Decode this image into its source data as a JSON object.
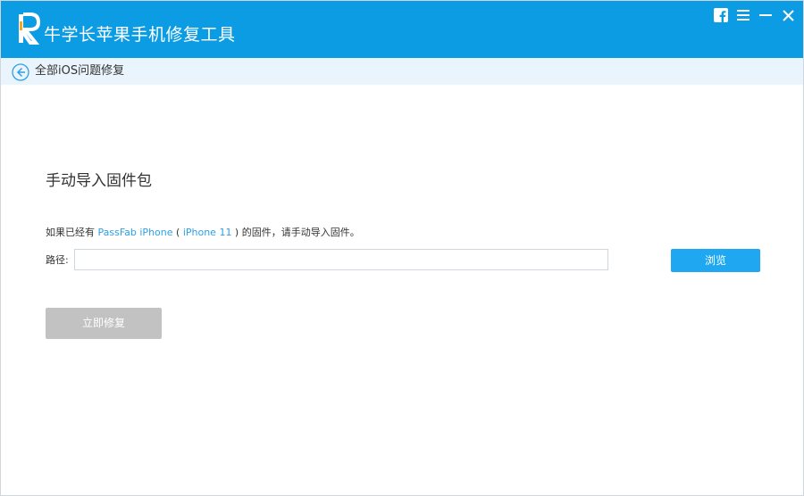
{
  "app": {
    "title": "牛学长苹果手机修复工具",
    "colors": {
      "titlebar": "#0c9ce4",
      "navbar": "#e9f4fc",
      "accent": "#1fa8f1",
      "link": "#2f9fe6",
      "disabled": "#c2c2c2"
    },
    "window_controls": [
      "facebook-icon",
      "menu-icon",
      "minimize-icon",
      "close-icon"
    ]
  },
  "nav": {
    "back_icon": "back-arrow-icon",
    "title": "全部iOS问题修复"
  },
  "main": {
    "section_title": "手动导入固件包",
    "info": {
      "prefix": "如果已经有 ",
      "product": "PassFab iPhone",
      "paren_open": " ( ",
      "device": "iPhone 11",
      "paren_close": " ) ",
      "suffix": "的固件，请手动导入固件。"
    },
    "path_label": "路径:",
    "path_value": "",
    "browse_label": "浏览",
    "repair_label": "立即修复"
  }
}
